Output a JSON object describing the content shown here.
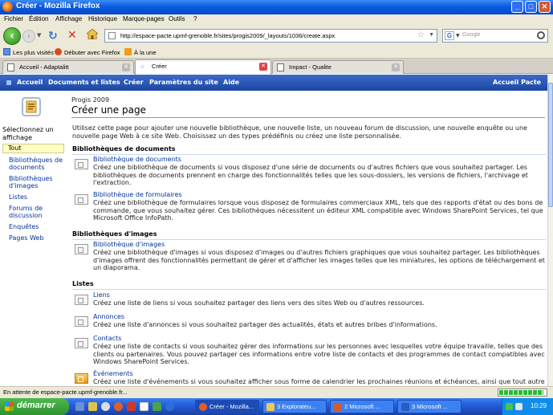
{
  "window": {
    "title": "Créer - Mozilla Firefox",
    "min": "_",
    "max": "□",
    "close": "✕"
  },
  "menu": [
    "Fichier",
    "Édition",
    "Affichage",
    "Historique",
    "Marque-pages",
    "Outils",
    "?"
  ],
  "nav": {
    "url": "http://espace-pacte.upmf-grenoble.fr/sites/progis2009/_layouts/1036/create.aspx",
    "search_placeholder": "Google"
  },
  "bookmarks": [
    "Les plus visités",
    "Débuter avec Firefox",
    "À la une"
  ],
  "tabs": [
    {
      "label": "Accueil - Adaptalitt",
      "active": false
    },
    {
      "label": "Créer",
      "active": true
    },
    {
      "label": "Impact - Qualite",
      "active": false
    }
  ],
  "sp_nav": [
    "Accueil",
    "Documents et listes",
    "Créer",
    "Paramètres du site",
    "Aide"
  ],
  "sp_nav_right": "Accueil Pacte",
  "breadcrumb": "Progis 2009",
  "page_title": "Créer une page",
  "quicklaunch": {
    "heading": "Sélectionnez un affichage",
    "selected": "Tout",
    "items": [
      "Bibliothèques de documents",
      "Bibliothèques d'images",
      "Listes",
      "Forums de discussion",
      "Enquêtes",
      "Pages Web"
    ]
  },
  "intro": "Utilisez cette page pour ajouter une nouvelle bibliothèque, une nouvelle liste, un nouveau forum de discussion, une nouvelle enquête ou une nouvelle page Web à ce site Web. Choisissez un des types prédéfinis ou créez une liste personnalisée.",
  "sections": [
    {
      "heading": "Bibliothèques de documents",
      "items": [
        {
          "name": "Bibliothèque de documents",
          "desc": "Créez une bibliothèque de documents si vous disposez d'une série de documents ou d'autres fichiers que vous souhaitez partager. Les bibliothèques de documents prennent en charge des fonctionnalités telles que les sous-dossiers, les versions de fichiers, l'archivage et l'extraction."
        },
        {
          "name": "Bibliothèque de formulaires",
          "desc": "Créez une bibliothèque de formulaires lorsque vous disposez de formulaires commerciaux XML, tels que des rapports d'état ou des bons de commande, que vous souhaitez gérer. Ces bibliothèques nécessitent un éditeur XML compatible avec Windows SharePoint Services, tel que Microsoft Office InfoPath."
        }
      ]
    },
    {
      "heading": "Bibliothèques d'images",
      "items": [
        {
          "name": "Bibliothèque d'images",
          "desc": "Créez une bibliothèque d'images si vous disposez d'images ou d'autres fichiers graphiques que vous souhaitez partager. Les bibliothèques d'images offrent des fonctionnalités permettant de gérer et d'afficher les images telles que les miniatures, les options de téléchargement et un diaporama."
        }
      ]
    },
    {
      "heading": "Listes",
      "items": [
        {
          "name": "Liens",
          "desc": "Créez une liste de liens si vous souhaitez partager des liens vers des sites Web ou d'autres ressources."
        },
        {
          "name": "Annonces",
          "desc": "Créez une liste d'annonces si vous souhaitez partager des actualités, états et autres bribes d'informations."
        },
        {
          "name": "Contacts",
          "desc": "Créez une liste de contacts si vous souhaitez gérer des informations sur les personnes avec lesquelles votre équipe travaille, telles que des clients ou partenaires. Vous pouvez partager ces informations entre votre liste de contacts et des programmes de contact compatibles avec Windows SharePoint Services."
        },
        {
          "name": "Événements",
          "desc": "Créez une liste d'événements si vous souhaitez afficher sous forme de calendrier les prochaines réunions et échéances, ainsi que tout autre"
        }
      ]
    }
  ],
  "status": {
    "text": "En attente de espace-pacte.upmf-grenoble.fr...",
    "progress": 0.95
  },
  "taskbar": {
    "start": "démarrer",
    "tasks": [
      "Créer - Mozilla...",
      "3 Explorateu...",
      "2 Microsoft ...",
      "3 Microsoft ..."
    ],
    "clock": "10:29"
  }
}
